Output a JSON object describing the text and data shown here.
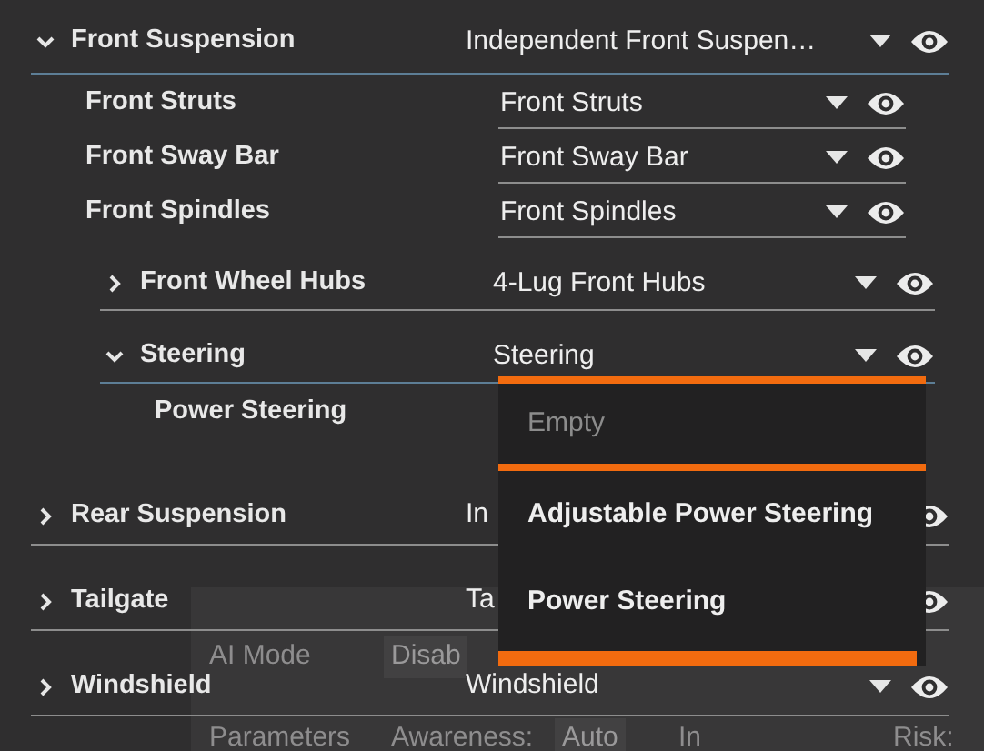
{
  "tree": [
    {
      "label": "Front Suspension",
      "value": "Independent Front Suspen…",
      "expanded": true,
      "children": [
        {
          "label": "Front Struts",
          "value": "Front Struts"
        },
        {
          "label": "Front Sway Bar",
          "value": "Front Sway Bar"
        },
        {
          "label": "Front Spindles",
          "value": "Front Spindles"
        },
        {
          "label": "Front Wheel Hubs",
          "value": "4-Lug Front Hubs",
          "expanded": false
        },
        {
          "label": "Steering",
          "value": "Steering",
          "expanded": true,
          "children": [
            {
              "label": "Power Steering",
              "dropdown_open": true
            }
          ]
        }
      ]
    },
    {
      "label": "Rear Suspension",
      "value": "In",
      "expanded": false
    },
    {
      "label": "Tailgate",
      "value": "Ta",
      "expanded": false
    },
    {
      "label": "Windshield",
      "value": "Windshield",
      "expanded": false
    }
  ],
  "dropdown_menu": {
    "options": [
      {
        "label": "Empty",
        "selected": true
      },
      {
        "label": "Adjustable Power Steering",
        "selected": false
      },
      {
        "label": "Power Steering",
        "selected": false
      }
    ]
  },
  "background_panel": {
    "ai_mode_label": "AI Mode",
    "ai_mode_value": "Disab",
    "parameters_label": "Parameters",
    "awareness_label": "Awareness:",
    "awareness_value": "Auto",
    "in_lane_label": "In",
    "risk_label": "Risk:"
  }
}
